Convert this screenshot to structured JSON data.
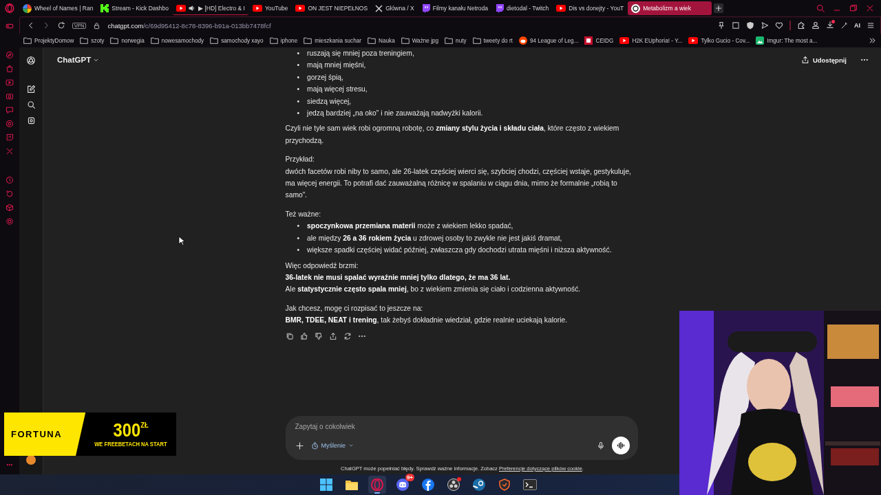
{
  "tabs": [
    {
      "kind": "wheel",
      "label": "Wheel of Names | Ran",
      "audio": false,
      "selected": false
    },
    {
      "kind": "kick",
      "label": "Stream - Kick Dashbo",
      "audio": false,
      "selected": false
    },
    {
      "kind": "youtube",
      "label": "▶ [HD] Electro & I",
      "audio": true,
      "selected": false
    },
    {
      "kind": "youtube",
      "label": "YouTube",
      "audio": false,
      "selected": false
    },
    {
      "kind": "youtube",
      "label": "ON JEST NIEPEŁNOS",
      "audio": false,
      "selected": false
    },
    {
      "kind": "x",
      "label": "Główna / X",
      "audio": false,
      "selected": false
    },
    {
      "kind": "twitch",
      "label": "Filmy kanału Netroda",
      "audio": false,
      "selected": false
    },
    {
      "kind": "twitch",
      "label": "dietodal - Twitch",
      "audio": false,
      "selected": false
    },
    {
      "kind": "youtube",
      "label": "Dis vs donejty - YouT",
      "audio": false,
      "selected": false
    },
    {
      "kind": "chatgpt",
      "label": "Metabolizm a wiek",
      "audio": false,
      "selected": true
    }
  ],
  "address": {
    "vpn": "VPN",
    "host": "chatgpt.com",
    "path": "/c/69d95412-8c78-8396-b91a-013bb7478fcf",
    "ai_label": "AI"
  },
  "bookmarks": [
    {
      "kind": "folder",
      "label": "ProjektyDomow"
    },
    {
      "kind": "folder",
      "label": "szoty"
    },
    {
      "kind": "folder",
      "label": "norwegia"
    },
    {
      "kind": "folder",
      "label": "nowesamochody"
    },
    {
      "kind": "folder",
      "label": "samochody xayo"
    },
    {
      "kind": "folder",
      "label": "iphone"
    },
    {
      "kind": "folder",
      "label": "mieszkania suchar"
    },
    {
      "kind": "folder",
      "label": "Nauka"
    },
    {
      "kind": "folder",
      "label": "Ważne jpg"
    },
    {
      "kind": "folder",
      "label": "nuty"
    },
    {
      "kind": "folder",
      "label": "tweety do rt"
    },
    {
      "kind": "reddit",
      "label": "94 League of Leg..."
    },
    {
      "kind": "ceidg",
      "label": "CEIDG"
    },
    {
      "kind": "youtube",
      "label": "H2K EUphoria! - Y..."
    },
    {
      "kind": "youtube",
      "label": "Tylko Gucio - Cov..."
    },
    {
      "kind": "imgur",
      "label": "Imgur: The most a..."
    }
  ],
  "header": {
    "model": "ChatGPT",
    "share": "Udostępnij"
  },
  "blocks": [
    {
      "kind": "list",
      "marker": "•",
      "items": [
        "ruszają się mniej poza treningiem,",
        "mają mniej mięśni,",
        "gorzej śpią,",
        "mają więcej stresu,",
        "siedzą więcej,",
        "jedzą bardziej „na oko” i nie zauważają nadwyżki kalorii."
      ]
    },
    {
      "kind": "para",
      "lines": [
        {
          "text": "Czyli nie tyle sam wiek robi ogromną robotę, co **zmiany stylu życia i składu ciała**, które często z wiekiem przychodzą.",
          "bold": false
        }
      ]
    },
    {
      "kind": "para",
      "lines": [
        {
          "text": "Przykład:",
          "bold": false
        },
        {
          "text": "dwóch facetów robi niby to samo, ale 26-latek częściej wierci się, szybciej chodzi, częściej wstaje, gestykuluje, ma więcej energii. To potrafi dać zauważalną różnicę w spalaniu w ciągu dnia, mimo że formalnie „robią to samo”.",
          "bold": false
        }
      ]
    },
    {
      "kind": "para",
      "lines": [
        {
          "text": "Też ważne:",
          "bold": false
        }
      ]
    },
    {
      "kind": "list",
      "marker": "•",
      "items": [
        "**spoczynkowa przemiana materii** może z wiekiem lekko spadać,",
        "ale między **26 a 36 rokiem życia** u zdrowej osoby to zwykle nie jest jakiś dramat,",
        "większe spadki częściej widać później, zwłaszcza gdy dochodzi utrata mięśni i niższa aktywność."
      ]
    },
    {
      "kind": "para",
      "lines": [
        {
          "text": "Więc odpowiedź brzmi:",
          "bold": false
        },
        {
          "text": "36-latek nie musi spalać wyraźnie mniej tylko dlatego, że ma 36 lat.",
          "bold": true
        },
        {
          "text": "Ale **statystycznie często spala mniej**, bo z wiekiem zmienia się ciało i codzienna aktywność.",
          "bold": false
        }
      ]
    },
    {
      "kind": "para",
      "lines": [
        {
          "text": "Jak chcesz, mogę ci rozpisać to jeszcze na:",
          "bold": false
        },
        {
          "text": "**BMR, TDEE, NEAT i trening**, tak żebyś dokładnie wiedział, gdzie realnie uciekają kalorie.",
          "bold": false
        }
      ]
    }
  ],
  "composer": {
    "placeholder": "Zapytaj o cokolwiek",
    "mode": "Myślenie"
  },
  "footer": {
    "text": "ChatGPT może popełniać błędy. Sprawdź ważne informacje. Zobacz ",
    "link": "Preferencje dotyczące plików cookie",
    "end": "."
  },
  "ad": {
    "brand": "FORTUNA",
    "amount": "300",
    "currency": "ZŁ",
    "tagline": "WE FREEBETACH NA START"
  },
  "taskbar": [
    {
      "kind": "windows",
      "selected": false,
      "dot": false
    },
    {
      "kind": "folder",
      "selected": false,
      "dot": false
    },
    {
      "kind": "opera",
      "selected": true,
      "dot": false
    },
    {
      "kind": "discord",
      "selected": false,
      "dot": false,
      "badge": "9+"
    },
    {
      "kind": "facebook",
      "selected": false,
      "dot": false
    },
    {
      "kind": "obs",
      "selected": false,
      "dot": true
    },
    {
      "kind": "steam",
      "selected": false,
      "dot": false
    },
    {
      "kind": "shield",
      "selected": false,
      "dot": false
    },
    {
      "kind": "terminal",
      "selected": false,
      "dot": false
    }
  ]
}
